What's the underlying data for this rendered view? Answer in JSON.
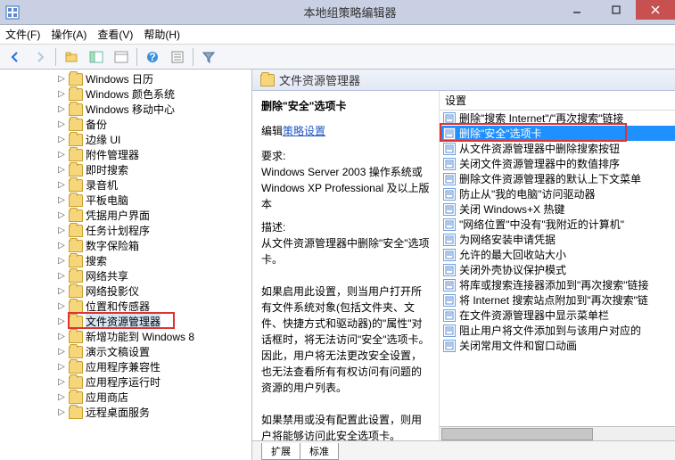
{
  "window": {
    "title": "本地组策略编辑器"
  },
  "menu": {
    "file": "文件(F)",
    "action": "操作(A)",
    "view": "查看(V)",
    "help": "帮助(H)"
  },
  "toolbar_icons": [
    "back",
    "forward",
    "up",
    "window",
    "item",
    "sep",
    "help",
    "props",
    "sep",
    "filter"
  ],
  "tree": [
    {
      "label": "Windows 日历"
    },
    {
      "label": "Windows 颜色系统"
    },
    {
      "label": "Windows 移动中心"
    },
    {
      "label": "备份"
    },
    {
      "label": "边缘 UI"
    },
    {
      "label": "附件管理器"
    },
    {
      "label": "即时搜索"
    },
    {
      "label": "录音机"
    },
    {
      "label": "平板电脑"
    },
    {
      "label": "凭据用户界面"
    },
    {
      "label": "任务计划程序"
    },
    {
      "label": "数字保险箱"
    },
    {
      "label": "搜索"
    },
    {
      "label": "网络共享"
    },
    {
      "label": "网络投影仪"
    },
    {
      "label": "位置和传感器"
    },
    {
      "label": "文件资源管理器",
      "selected": true,
      "highlighted": true
    },
    {
      "label": "新增功能到 Windows 8"
    },
    {
      "label": "演示文稿设置"
    },
    {
      "label": "应用程序兼容性"
    },
    {
      "label": "应用程序运行时"
    },
    {
      "label": "应用商店"
    },
    {
      "label": "远程桌面服务"
    }
  ],
  "content": {
    "header": "文件资源管理器",
    "desc_title": "删除\"安全\"选项卡",
    "edit_label": "编辑",
    "edit_link": "策略设置",
    "requirement_label": "要求:",
    "requirement_text": "Windows Server 2003 操作系统或 Windows XP Professional 及以上版本",
    "description_label": "描述:",
    "description_text": "从文件资源管理器中删除\"安全\"选项卡。\n\n如果启用此设置，则当用户打开所有文件系统对象(包括文件夹、文件、快捷方式和驱动器)的\"属性\"对话框时，将无法访问\"安全\"选项卡。因此，用户将无法更改安全设置，也无法查看所有有权访问有问题的资源的用户列表。\n\n如果禁用或没有配置此设置，则用户将能够访问此安全选项卡。",
    "settings_header": "设置",
    "settings": [
      {
        "label": "删除\"搜索 Internet\"/\"再次搜索\"链接"
      },
      {
        "label": "删除\"安全\"选项卡",
        "selected": true,
        "highlighted": true
      },
      {
        "label": "从文件资源管理器中删除搜索按钮"
      },
      {
        "label": "关闭文件资源管理器中的数值排序"
      },
      {
        "label": "删除文件资源管理器的默认上下文菜单"
      },
      {
        "label": "防止从\"我的电脑\"访问驱动器"
      },
      {
        "label": "关闭 Windows+X 热键"
      },
      {
        "label": "\"网络位置\"中没有\"我附近的计算机\""
      },
      {
        "label": "为网络安装申请凭据"
      },
      {
        "label": "允许的最大回收站大小"
      },
      {
        "label": "关闭外壳协议保护模式"
      },
      {
        "label": "将库或搜索连接器添加到\"再次搜索\"链接"
      },
      {
        "label": "将 Internet 搜索站点附加到\"再次搜索\"链"
      },
      {
        "label": "在文件资源管理器中显示菜单栏"
      },
      {
        "label": "阻止用户将文件添加到与该用户对应的"
      },
      {
        "label": "关闭常用文件和窗口动画"
      }
    ],
    "tabs": {
      "extended": "扩展",
      "standard": "标准"
    }
  }
}
